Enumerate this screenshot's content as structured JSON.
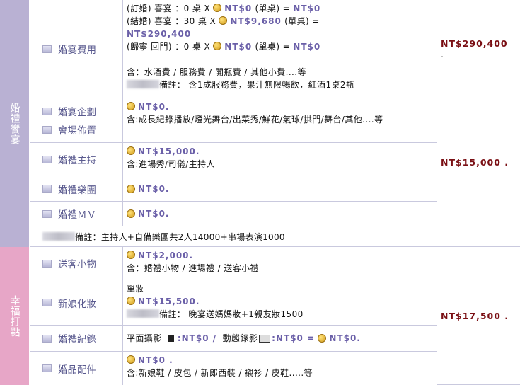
{
  "section1": {
    "title": "婚禮饗宴"
  },
  "section2": {
    "title": "幸福打點"
  },
  "rows": {
    "banquet": {
      "label": "婚宴費用",
      "lines": [
        {
          "pre": "(訂婚) 喜宴 ：0  桌  X ",
          "price": "NT$0",
          "post": " (單桌) =     ",
          "total": "NT$0"
        },
        {
          "pre": "(結婚) 喜宴 ：30  桌  X ",
          "price": "NT$9,680",
          "post": " (單桌) =",
          "total": "NT$290,400"
        },
        {
          "pre": "(歸寧 回門) ：0  桌  X ",
          "price": "NT$0",
          "post": " (單桌) =     ",
          "total": "NT$0"
        }
      ],
      "includes": "含：水酒費 / 服務費 /  開瓶費 / 其他小費....等",
      "remark": "備註： 含1成服務費，果汁無限暢飲，紅酒1桌2瓶",
      "sum": "NT$290,400",
      "sum_suffix": "."
    },
    "planning": {
      "label1": "婚宴企劃",
      "label2": "會場佈置",
      "price": "NT$0.",
      "desc": "含:成長紀錄播放/燈光舞台/出菜秀/鮮花/氣球/拱門/舞台/其他....等"
    },
    "host": {
      "label": "婚禮主持",
      "price": "NT$15,000.",
      "desc": "含:進場秀/司儀/主持人",
      "sum": "NT$15,000 ."
    },
    "band": {
      "label": "婚禮樂團",
      "price": "NT$0."
    },
    "mv": {
      "label": "婚禮ＭＶ",
      "price": "NT$0."
    },
    "note1": "備註：主持人+自備樂團共2人14000+串場表演1000",
    "gift": {
      "label": "送客小物",
      "price": "NT$2,000.",
      "desc": "含：婚禮小物 / 進場禮 / 送客小禮"
    },
    "makeup": {
      "label": "新娘化妝",
      "type": "單妝",
      "price": "NT$15,500.",
      "remark": "備註： 晚宴送媽媽妝+1親友妝1500",
      "sum": "NT$17,500 ."
    },
    "record": {
      "label": "婚禮紀錄",
      "photo_label": "平面攝影",
      "photo_price": ":NT$0 /",
      "video_label": "動態錄影",
      "video_price": ":NT$0 =",
      "total": "NT$0."
    },
    "goods": {
      "label": "婚品配件",
      "price": "NT$0 .",
      "desc": "含:新娘鞋 / 皮包 / 新郎西裝 / 襯衫 / 皮鞋.....等"
    }
  }
}
